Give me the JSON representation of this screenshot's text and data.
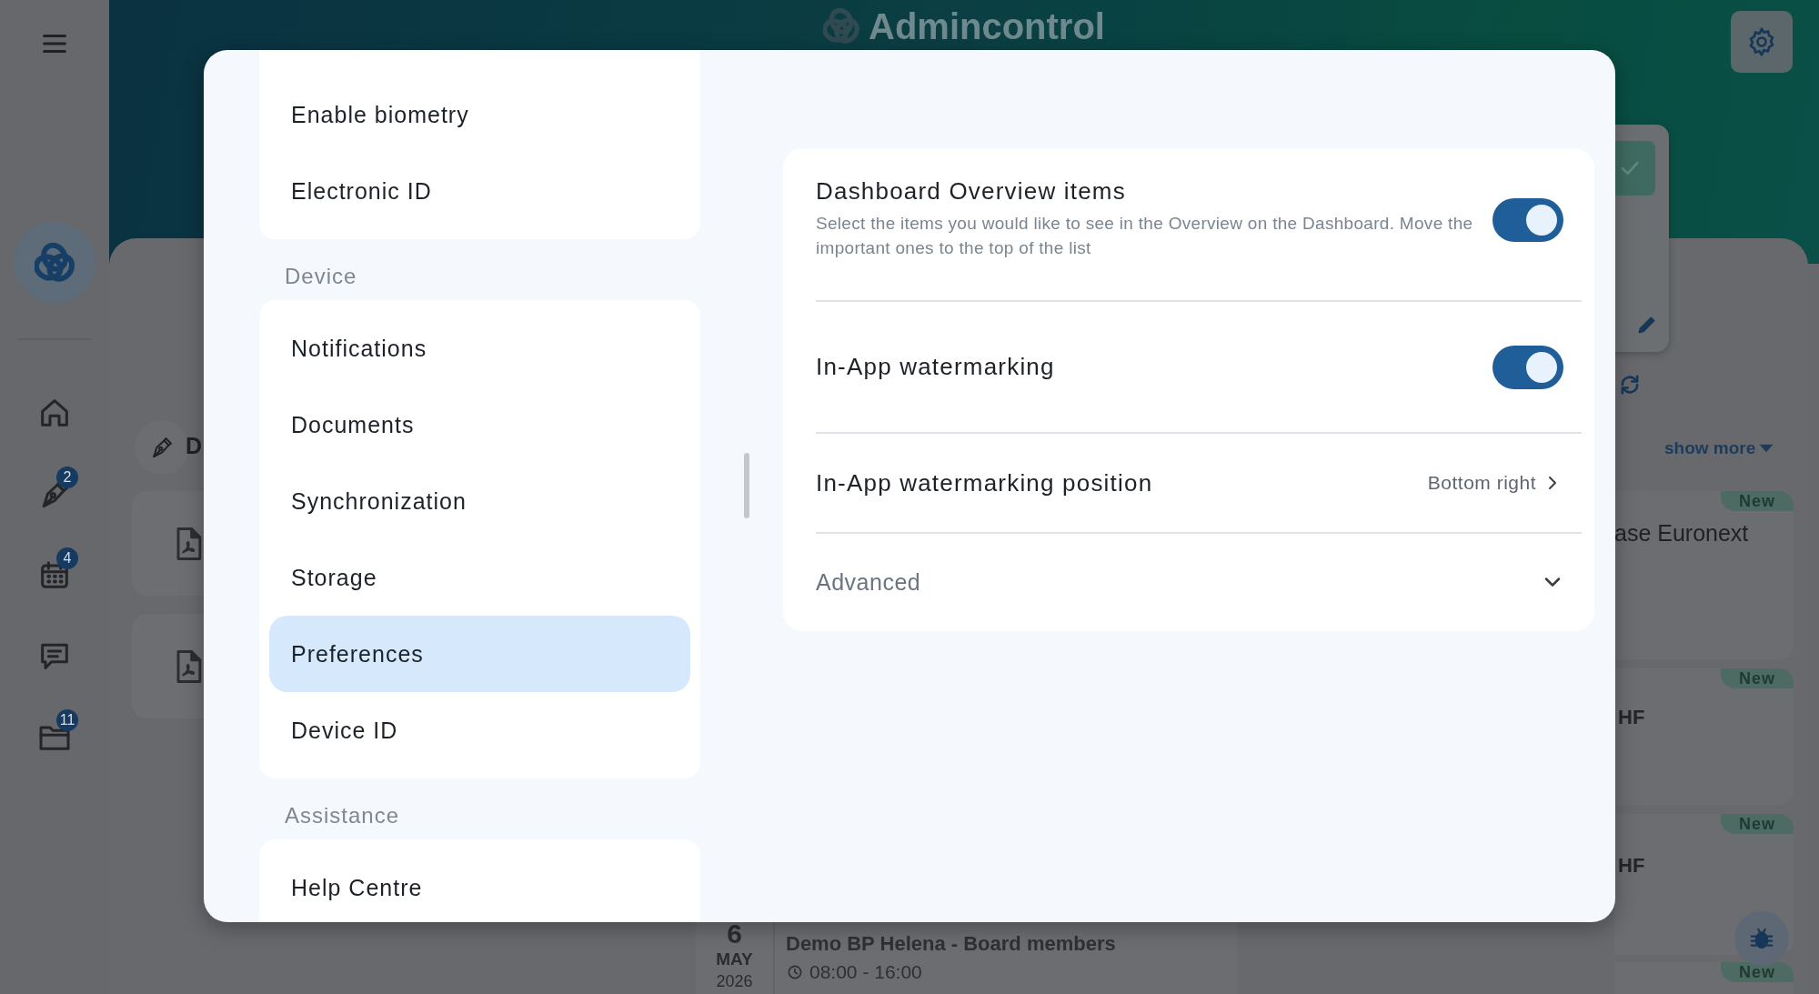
{
  "app": {
    "title": "Admincontrol",
    "rail": [
      {
        "kind": "home"
      },
      {
        "kind": "pen",
        "badge": "2"
      },
      {
        "kind": "calendar",
        "badge": "4"
      },
      {
        "kind": "chat"
      },
      {
        "kind": "folder",
        "badge": "11"
      }
    ],
    "section_heading": "D",
    "side_panel": {
      "show_more": "show more",
      "cards": [
        {
          "badge": "New",
          "text": "ase Euronext"
        },
        {
          "badge": "New",
          "text": "HF"
        },
        {
          "badge": "New",
          "text": "HF"
        },
        {
          "badge": "New"
        }
      ]
    },
    "event": {
      "day": "6",
      "month": "MAY",
      "year": "2026",
      "title": "Demo BP Helena - Board members",
      "time": "08:00 - 16:00"
    }
  },
  "settings": {
    "menu": {
      "sections": [
        {
          "items": [
            {
              "label": "Enable biometry",
              "selected": false
            },
            {
              "label": "Electronic ID",
              "selected": false
            }
          ]
        },
        {
          "heading": "Device",
          "items": [
            {
              "label": "Notifications",
              "selected": false
            },
            {
              "label": "Documents",
              "selected": false
            },
            {
              "label": "Synchronization",
              "selected": false
            },
            {
              "label": "Storage",
              "selected": false
            },
            {
              "label": "Preferences",
              "selected": true
            },
            {
              "label": "Device ID",
              "selected": false
            }
          ]
        },
        {
          "heading": "Assistance",
          "items": [
            {
              "label": "Help Centre",
              "selected": false
            }
          ]
        }
      ]
    },
    "rows": [
      {
        "kind": "toggle",
        "title": "Dashboard Overview items",
        "description": "Select the items you would like to see in the Overview on the Dashboard. Move the important ones to the top of the list",
        "on": true
      },
      {
        "kind": "toggle",
        "title": "In-App watermarking",
        "on": true
      },
      {
        "kind": "link",
        "title": "In-App watermarking position",
        "value": "Bottom right"
      },
      {
        "kind": "expander",
        "title": "Advanced",
        "expanded": false
      }
    ]
  }
}
